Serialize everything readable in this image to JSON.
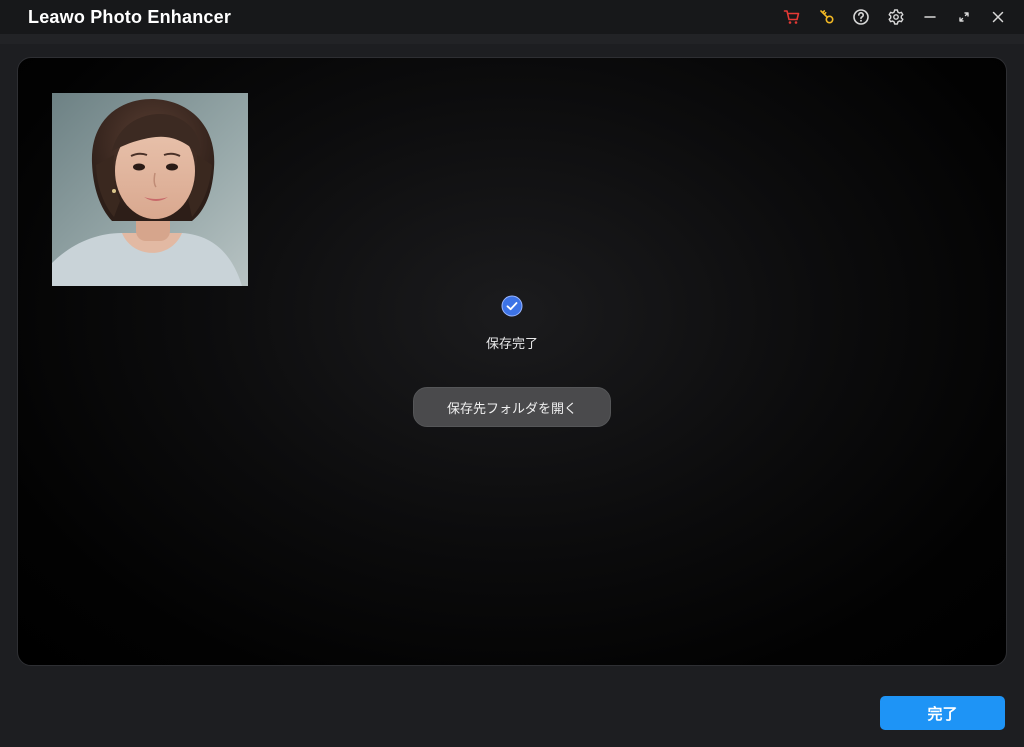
{
  "window": {
    "title": "Leawo Photo Enhancer"
  },
  "titlebar": {
    "icons": [
      "cart-icon",
      "key-icon",
      "help-icon",
      "settings-icon",
      "minimize-icon",
      "restore-icon",
      "close-icon"
    ],
    "colors": {
      "cart": "#e53935",
      "key": "#f2b824",
      "default": "#d8d8d8"
    }
  },
  "preview": {
    "thumbnail": "portrait-photo",
    "status_icon": "check-circle-icon",
    "status_text": "保存完了",
    "open_folder_label": "保存先フォルダを開く"
  },
  "footer": {
    "done_label": "完了"
  },
  "colors": {
    "accent": "#1e94f6",
    "check": "#3d73e6",
    "background": "#1d1e21"
  }
}
